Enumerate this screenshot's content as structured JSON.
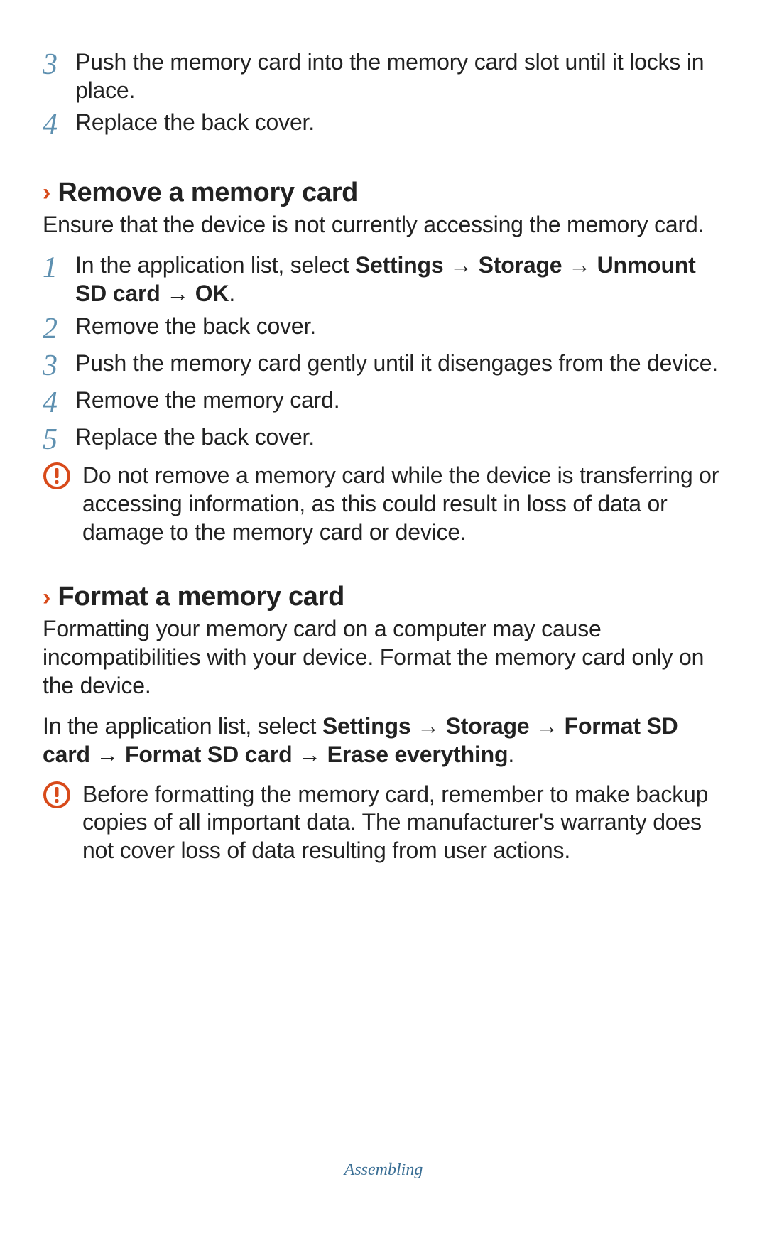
{
  "top_steps": [
    {
      "num": "3",
      "text": "Push the memory card into the memory card slot until it locks in place."
    },
    {
      "num": "4",
      "text": "Replace the back cover."
    }
  ],
  "remove": {
    "heading": "Remove a memory card",
    "intro": "Ensure that the device is not currently accessing the memory card.",
    "step1_prefix": "In the application list, select ",
    "step1_b1": "Settings",
    "step1_arrow": " → ",
    "step1_b2": "Storage",
    "step1_b3": "Unmount SD card",
    "step1_b4": "OK",
    "step1_period": ".",
    "steps_rest": [
      {
        "num": "2",
        "text": "Remove the back cover."
      },
      {
        "num": "3",
        "text": "Push the memory card gently until it disengages from the device."
      },
      {
        "num": "4",
        "text": "Remove the memory card."
      },
      {
        "num": "5",
        "text": "Replace the back cover."
      }
    ],
    "warning": "Do not remove a memory card while the device is transferring or accessing information, as this could result in loss of data or damage to the memory card or device."
  },
  "format": {
    "heading": "Format a memory card",
    "intro": "Formatting your memory card on a computer may cause incompatibilities with your device. Format the memory card only on the device.",
    "path_prefix": "In the application list, select ",
    "b1": "Settings",
    "arrow": " → ",
    "b2": "Storage",
    "b3": "Format SD card",
    "b4": "Format SD card",
    "b5": "Erase everything",
    "period": ".",
    "warning": "Before formatting the memory card, remember to make backup copies of all important data. The manufacturer's warranty does not cover loss of data resulting from user actions."
  },
  "footer": "Assembling",
  "numbers": {
    "one": "1"
  }
}
